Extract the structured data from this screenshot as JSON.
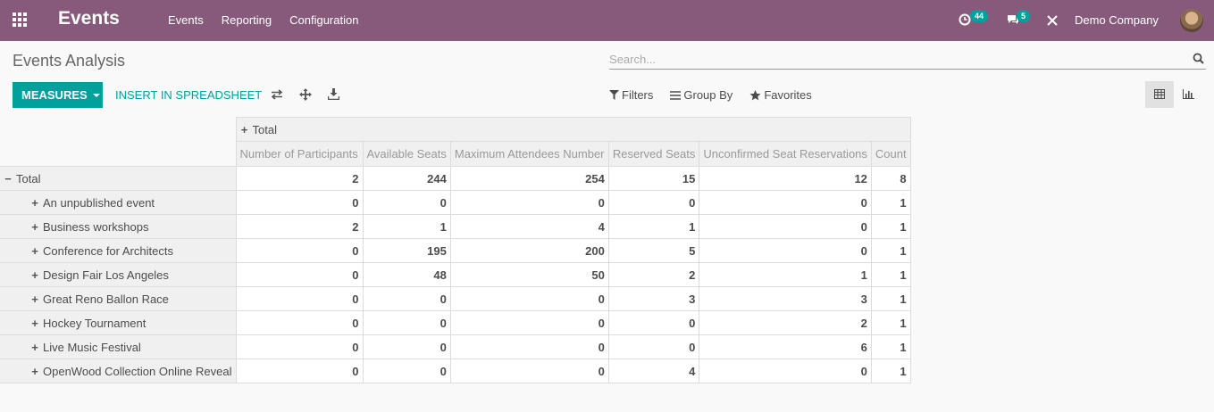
{
  "app": {
    "brand": "Events"
  },
  "nav": {
    "menu": [
      "Events",
      "Reporting",
      "Configuration"
    ]
  },
  "systray": {
    "activity_count": "44",
    "messages_count": "5",
    "company": "Demo Company"
  },
  "control_panel": {
    "title": "Events Analysis",
    "search_placeholder": "Search...",
    "measures_label": "MEASURES",
    "spreadsheet_label": "INSERT IN SPREADSHEET",
    "filters_label": "Filters",
    "group_by_label": "Group By",
    "favorites_label": "Favorites"
  },
  "pivot": {
    "column_group": "Total",
    "row_group": "Total",
    "measures": [
      "Number of Participants",
      "Available Seats",
      "Maximum Attendees Number",
      "Reserved Seats",
      "Unconfirmed Seat Reservations",
      "Count"
    ],
    "total_values": [
      "2",
      "244",
      "254",
      "15",
      "12",
      "8"
    ],
    "rows": [
      {
        "label": "An unpublished event",
        "values": [
          "0",
          "0",
          "0",
          "0",
          "0",
          "1"
        ]
      },
      {
        "label": "Business workshops",
        "values": [
          "2",
          "1",
          "4",
          "1",
          "0",
          "1"
        ]
      },
      {
        "label": "Conference for Architects",
        "values": [
          "0",
          "195",
          "200",
          "5",
          "0",
          "1"
        ]
      },
      {
        "label": "Design Fair Los Angeles",
        "values": [
          "0",
          "48",
          "50",
          "2",
          "1",
          "1"
        ]
      },
      {
        "label": "Great Reno Ballon Race",
        "values": [
          "0",
          "0",
          "0",
          "3",
          "3",
          "1"
        ]
      },
      {
        "label": "Hockey Tournament",
        "values": [
          "0",
          "0",
          "0",
          "0",
          "2",
          "1"
        ]
      },
      {
        "label": "Live Music Festival",
        "values": [
          "0",
          "0",
          "0",
          "0",
          "6",
          "1"
        ]
      },
      {
        "label": "OpenWood Collection Online Reveal",
        "values": [
          "0",
          "0",
          "0",
          "4",
          "0",
          "1"
        ]
      }
    ]
  }
}
